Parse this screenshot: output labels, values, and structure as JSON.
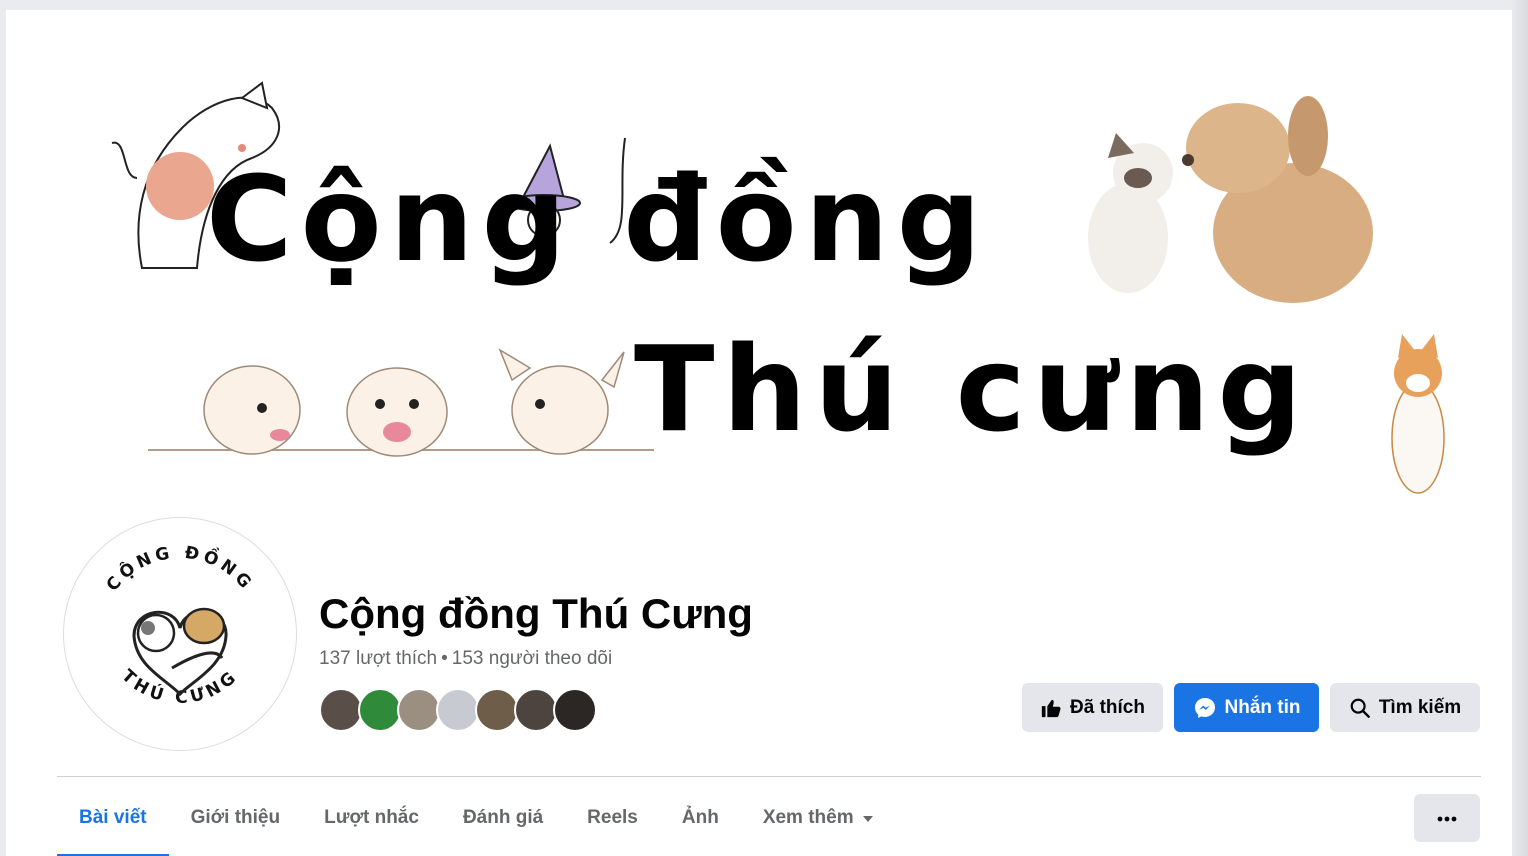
{
  "cover": {
    "line1": "Cộng đồng",
    "line2": "Thú cưng"
  },
  "avatar": {
    "top_text": "CỘNG ĐỒNG",
    "bottom_text": "THÚ CƯNG"
  },
  "page": {
    "title": "Cộng đồng Thú Cưng",
    "likes": "137 lượt thích",
    "separator": "•",
    "followers": "153 người theo dõi"
  },
  "friends": {
    "colors": [
      "#5a4e48",
      "#2f8a3a",
      "#9a8f80",
      "#c7cbd1",
      "#6d5d49",
      "#4d443f",
      "#2c2624"
    ]
  },
  "actions": {
    "liked": {
      "label": "Đã thích",
      "icon": "thumbs-up-icon"
    },
    "message": {
      "label": "Nhắn tin",
      "icon": "messenger-icon"
    },
    "search": {
      "label": "Tìm kiếm",
      "icon": "search-icon"
    }
  },
  "tabs": [
    {
      "label": "Bài viết",
      "active": true
    },
    {
      "label": "Giới thiệu",
      "active": false
    },
    {
      "label": "Lượt nhắc",
      "active": false
    },
    {
      "label": "Đánh giá",
      "active": false
    },
    {
      "label": "Reels",
      "active": false
    },
    {
      "label": "Ảnh",
      "active": false
    },
    {
      "label": "Xem thêm",
      "active": false
    }
  ],
  "colors": {
    "accent": "#1b74e4",
    "button_grey": "#e4e6eb",
    "secondary_text": "#65676b"
  }
}
